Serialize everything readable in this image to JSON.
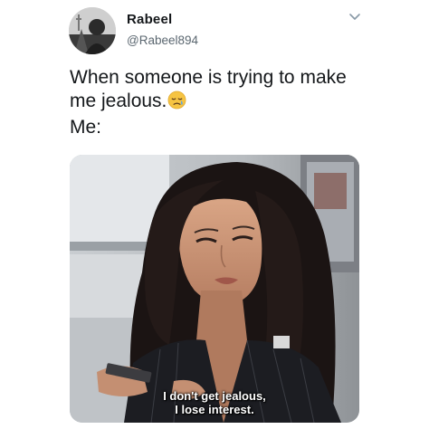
{
  "author": {
    "display_name": "Rabeel",
    "handle": "@Rabeel894",
    "avatar_icon": "profile-photo",
    "menu_icon": "chevron-down-icon"
  },
  "tweet": {
    "lines": [
      "When someone is trying to make",
      "me jealous.",
      "Me:"
    ],
    "emoji": "sad-relieved-face-emoji"
  },
  "media": {
    "caption_line1": "I don't get jealous,",
    "caption_line2": "I lose interest."
  },
  "colors": {
    "text": "#14171a",
    "secondary_text": "#5b6770",
    "caption": "#ffffff"
  }
}
